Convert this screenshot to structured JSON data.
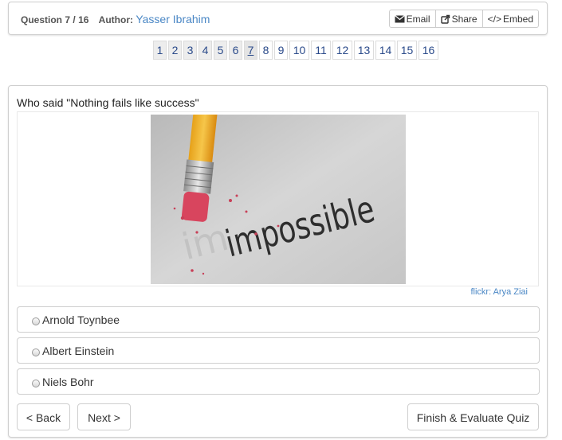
{
  "header": {
    "question_label": "Question",
    "question_current": "7",
    "question_total": "16",
    "author_label": "Author:",
    "author_name": "Yasser Ibrahim",
    "share_buttons": {
      "email": "Email",
      "share": "Share",
      "embed": "Embed"
    },
    "icons": [
      "envelope-icon",
      "share-arrow-icon",
      "code-icon"
    ]
  },
  "pagination": {
    "pages": [
      "1",
      "2",
      "3",
      "4",
      "5",
      "6",
      "7",
      "8",
      "9",
      "10",
      "11",
      "12",
      "13",
      "14",
      "15",
      "16"
    ],
    "active": "7"
  },
  "question": {
    "text": "Who said \"Nothing fails like success\"",
    "image_text": "impossible",
    "image_credit": "flickr: Arya Ziai"
  },
  "answers": [
    {
      "label": "Arnold Toynbee"
    },
    {
      "label": "Albert Einstein"
    },
    {
      "label": "Niels Bohr"
    }
  ],
  "actions": {
    "back": "< Back",
    "next": "Next >",
    "finish": "Finish & Evaluate Quiz"
  },
  "colors": {
    "link": "#4a87c5",
    "page_link": "#2a4a8a",
    "border": "#cfcfcf"
  }
}
